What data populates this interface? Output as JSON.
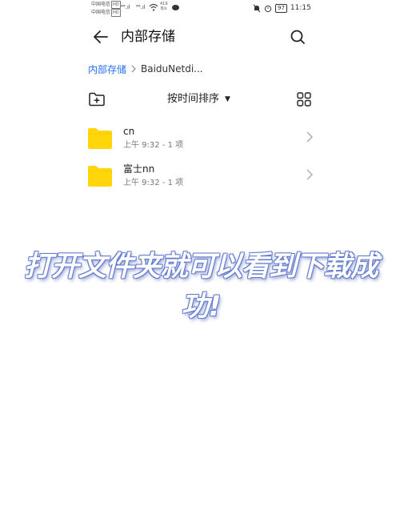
{
  "status_bar": {
    "carrier1": "中国电信",
    "carrier1_tag": "HD",
    "carrier2": "中国电信",
    "carrier2_tag": "HD",
    "signal1": "⁴⁶.ıl",
    "signal2": "⁴⁶.ıl",
    "net_speed_value": "419",
    "net_speed_unit": "B/s",
    "battery": "97",
    "time": "11:15"
  },
  "appbar": {
    "title": "内部存储",
    "back_icon": "arrow-left-icon",
    "search_icon": "search-icon"
  },
  "breadcrumb": {
    "root": "内部存储",
    "current": "BaiduNetdi..."
  },
  "toolbar": {
    "sort_label": "按时间排序",
    "sort_caret": "▼"
  },
  "files": [
    {
      "name": "cn",
      "meta": "上午 9:32  - 1 项"
    },
    {
      "name": "富士nn",
      "meta": "上午 9:32  - 1 项"
    }
  ],
  "overlay_caption": "打开文件夹就可以看到下载成功!",
  "colors": {
    "accent": "#256fff",
    "folder": "#ffd60a",
    "caption_outline": "#6b82d6"
  }
}
